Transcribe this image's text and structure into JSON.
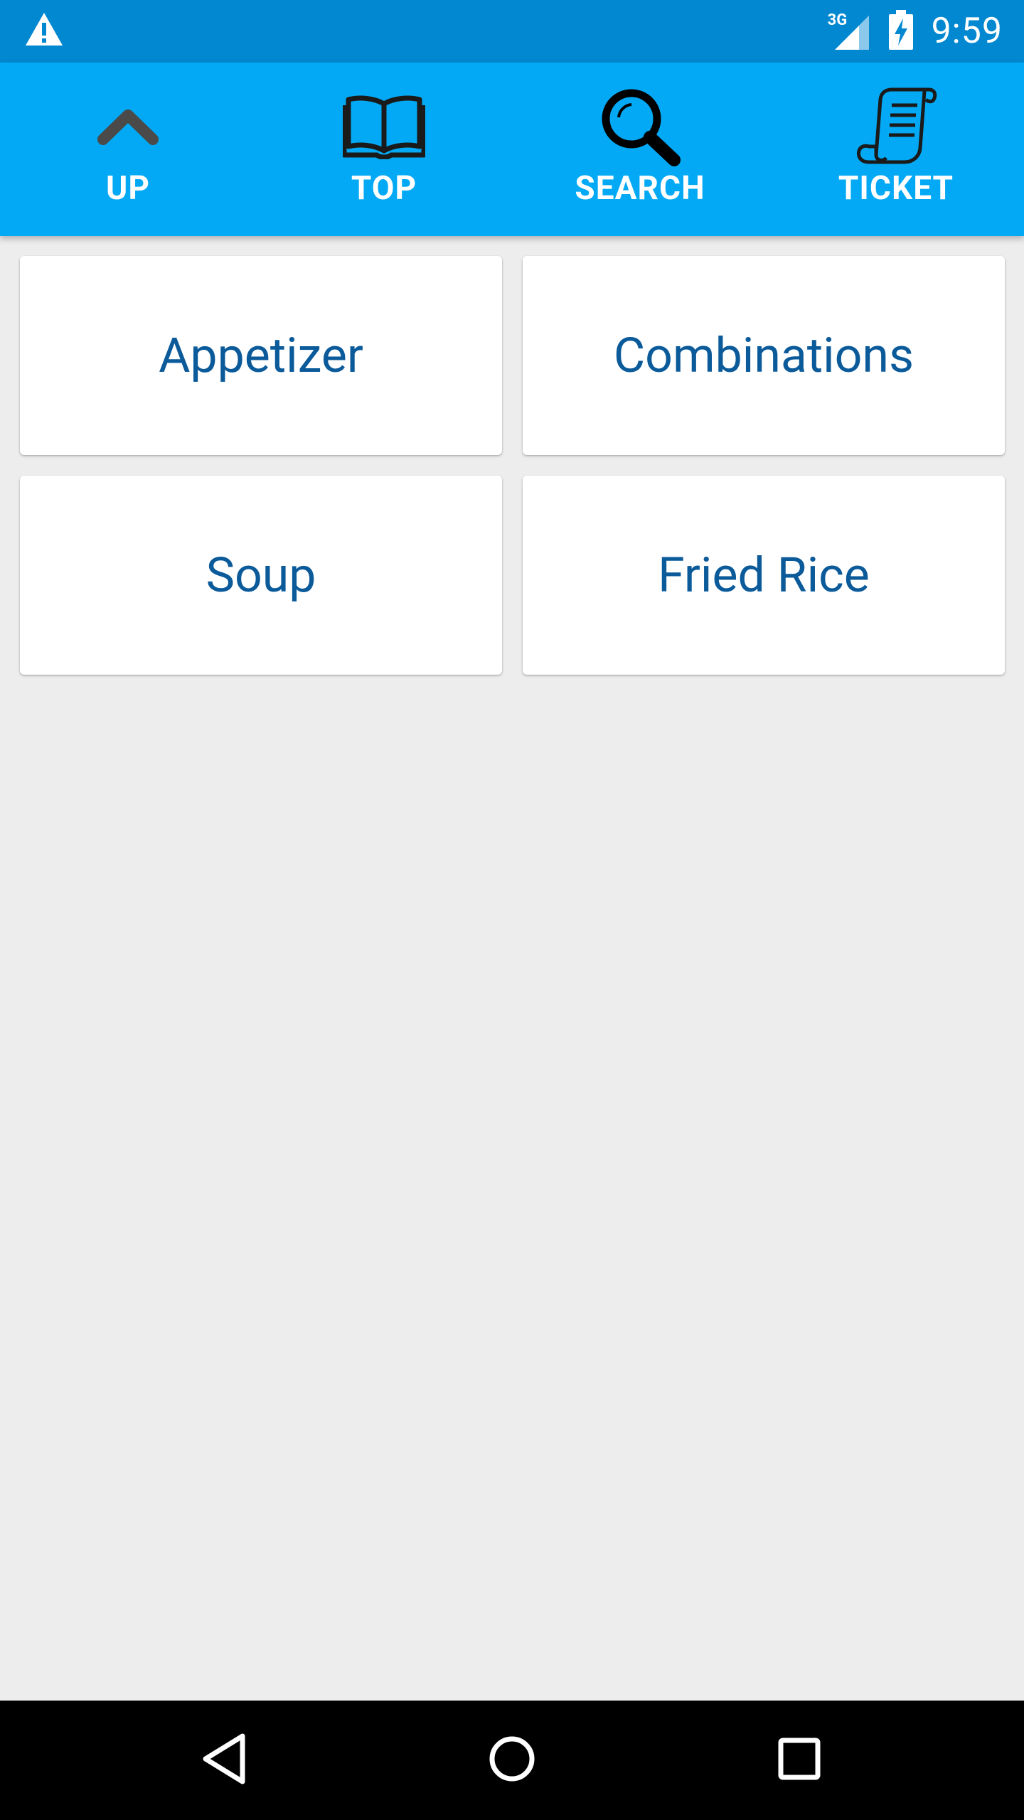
{
  "status_bar": {
    "network": "3G",
    "time": "9:59",
    "icons": [
      "warning-icon",
      "signal-icon",
      "battery-charging-icon"
    ]
  },
  "toolbar": {
    "items": [
      {
        "label": "UP",
        "icon": "chevron-up-icon"
      },
      {
        "label": "TOP",
        "icon": "book-icon"
      },
      {
        "label": "SEARCH",
        "icon": "search-icon"
      },
      {
        "label": "TICKET",
        "icon": "receipt-icon"
      }
    ]
  },
  "categories": [
    {
      "label": "Appetizer"
    },
    {
      "label": "Combinations"
    },
    {
      "label": "Soup"
    },
    {
      "label": "Fried Rice"
    }
  ],
  "navigation": {
    "icons": [
      "back-icon",
      "home-icon",
      "recents-icon"
    ]
  },
  "colors": {
    "status_bar": "#0288d1",
    "toolbar": "#03a9f4",
    "background": "#ededed",
    "card_text": "#0b5a9a"
  }
}
